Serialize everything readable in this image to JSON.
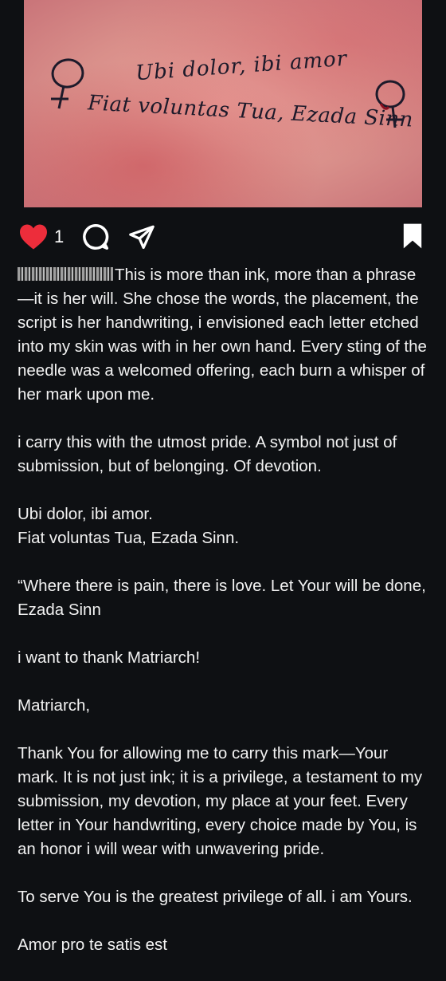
{
  "post_image": {
    "tattoo_line_1": "Ubi dolor, ibi amor",
    "tattoo_line_2": "Fiat voluntas Tua, Ezada Sinn"
  },
  "actions": {
    "like_count": "1",
    "liked": true,
    "icons": [
      "heart-icon",
      "comment-icon",
      "share-icon",
      "bookmark-icon"
    ],
    "colors": {
      "heart": "#ed2d3b",
      "icons": "#ffffff"
    }
  },
  "caption": {
    "username_pixelated": true,
    "paragraphs": [
      "This is more than ink, more than a phrase—it is her will. She chose the words, the placement, the script is her handwriting, i envisioned each letter etched into my skin was with in her own hand. Every sting of the needle was a welcomed offering, each burn a whisper of her mark upon me.",
      "i carry this with the utmost pride. A symbol not just of submission, but of belonging. Of devotion.",
      "Ubi dolor, ibi amor.\nFiat voluntas Tua, Ezada Sinn.",
      "“Where there is pain, there is love. Let Your will be done, Ezada Sinn",
      "i want to thank Matriarch!",
      "Matriarch,",
      "Thank You for allowing me to carry this mark—Your mark. It is not just ink; it is a privilege, a testament to my submission, my devotion, my place at your feet. Every letter in Your handwriting, every choice made by You, is an honor i will wear with unwavering pride.",
      "To serve You is the greatest privilege of all. i am Yours.",
      "Amor pro te satis est"
    ]
  }
}
